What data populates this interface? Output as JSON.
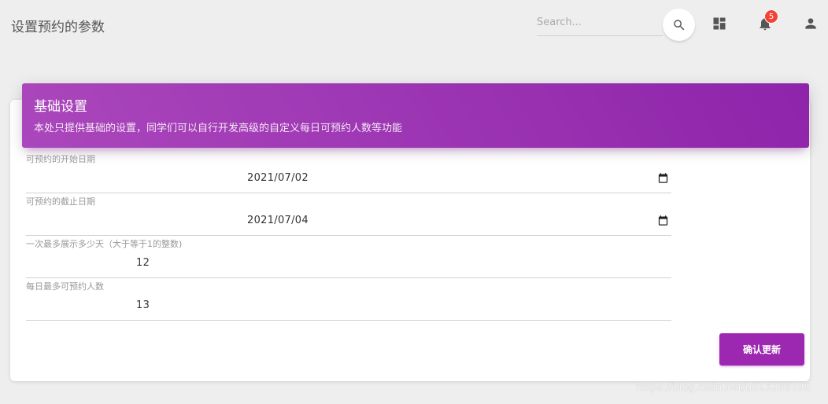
{
  "navbar": {
    "brand": "设置预约的参数",
    "search_placeholder": "Search...",
    "notification_count": "5",
    "icons": [
      "search-icon",
      "dashboard-icon",
      "bell-icon",
      "person-icon"
    ]
  },
  "card": {
    "title": "基础设置",
    "category": "本处只提供基础的设置，同学们可以自行开发高级的自定义每日可预约人数等功能"
  },
  "form": {
    "start_date": {
      "label": "可预约的开始日期",
      "value": "2021/07/02"
    },
    "end_date": {
      "label": "可预约的截止日期",
      "value": "2021/07/04"
    },
    "max_days": {
      "label": "一次最多展示多少天（大于等于1的整数)",
      "value": "12"
    },
    "max_per_day": {
      "label": "每日最多可预约人数",
      "value": "13"
    },
    "submit_label": "确认更新"
  },
  "watermark": "https://blog.csdn.net/u013288190",
  "colors": {
    "accent": "#9c27b0",
    "header_gradient_start": "#ab47bc",
    "header_gradient_end": "#8e24aa",
    "badge": "#f44336",
    "background": "#eeeeee"
  }
}
